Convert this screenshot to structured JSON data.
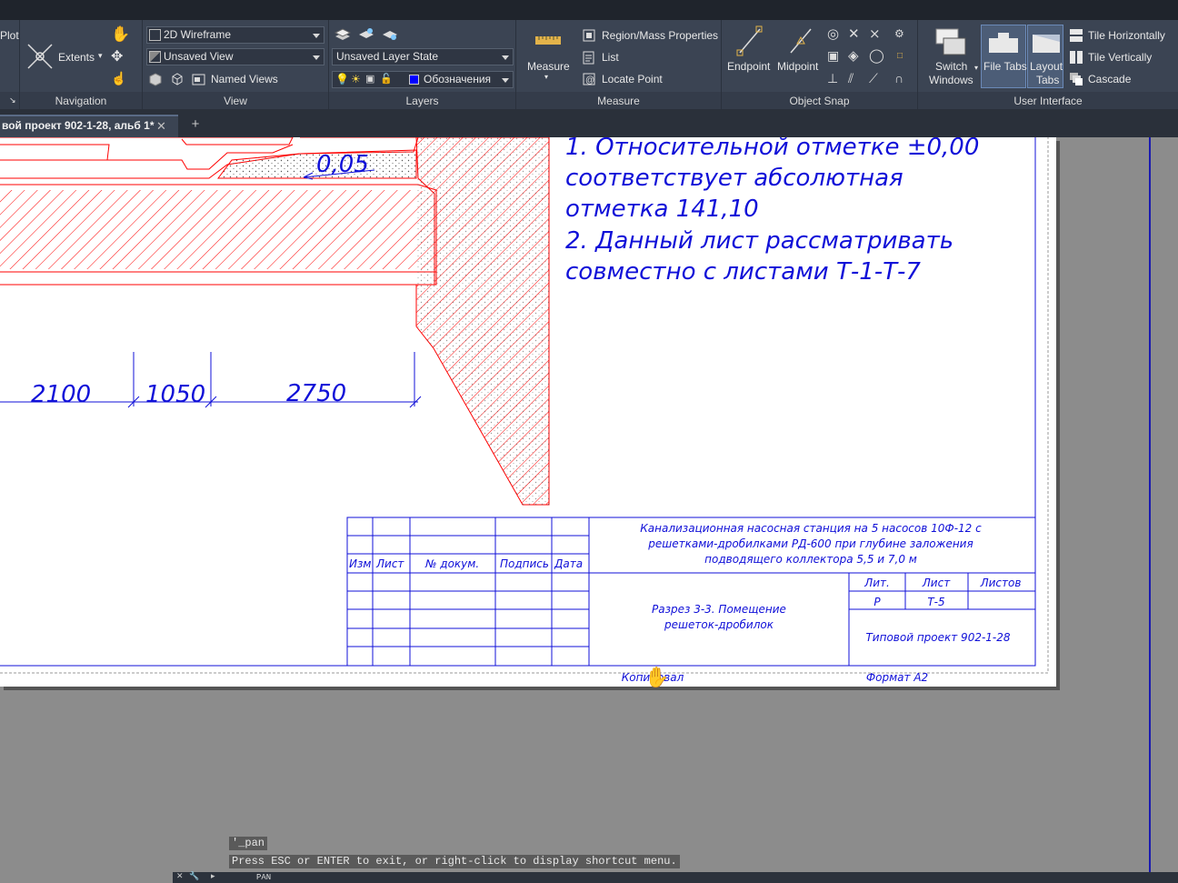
{
  "ribbon": {
    "plot_fragment": "Plot",
    "navigation": {
      "title": "Navigation",
      "extents_label": "Extents"
    },
    "view": {
      "title": "View",
      "visual_style": "2D Wireframe",
      "named_view_combo": "Unsaved View",
      "named_views_label": "Named Views"
    },
    "layers": {
      "title": "Layers",
      "layer_state": "Unsaved Layer State",
      "current_layer": "Обозначения",
      "layer_color": "#0000ff"
    },
    "measure": {
      "title": "Measure",
      "measure_label": "Measure",
      "region_mass": "Region/Mass Properties",
      "list": "List",
      "locate_point": "Locate Point"
    },
    "object_snap": {
      "title": "Object Snap",
      "endpoint": "Endpoint",
      "midpoint": "Midpoint"
    },
    "user_interface": {
      "title": "User Interface",
      "switch_windows_1": "Switch",
      "switch_windows_2": "Windows",
      "file_tabs": "File Tabs",
      "layout_tabs_1": "Layout",
      "layout_tabs_2": "Tabs",
      "tile_horizontally": "Tile Horizontally",
      "tile_vertically": "Tile Vertically",
      "cascade": "Cascade"
    }
  },
  "file_tab": {
    "label": "вой проект 902-1-28, альб 1*",
    "close": "✕",
    "new": "+"
  },
  "drawing": {
    "notes": [
      "1. Относительной отметке ±0,00",
      "соответствует абсолютная",
      "отметка 141,10",
      "2. Данный лист рассматривать",
      "совместно с листами Т-1-Т-7"
    ],
    "slope_label": "0,05",
    "dimensions": [
      "2100",
      "1050",
      "2750"
    ],
    "title_block": {
      "headers": [
        "Изм",
        "Лист",
        "№ докум.",
        "Подпись",
        "Дата"
      ],
      "project_title": [
        "Канализационная насосная станция на 5 насосов 10Ф-12 с",
        "решетками-дробилками РД-600 при глубине заложения",
        "подводящего коллектора 5,5 и 7,0 м"
      ],
      "sheet_title": [
        "Разрез 3-3. Помещение",
        "решеток-дробилок"
      ],
      "lit_header": "Лит.",
      "sheet_header": "Лист",
      "sheets_header": "Листов",
      "lit_value": "Р",
      "sheet_value": "Т-5",
      "typical_project": "Типовой проект 902-1-28",
      "copied": "Копировал",
      "format": "Формат А2"
    }
  },
  "command_line": {
    "history_1": "'_pan",
    "history_2": "Press ESC or ENTER to exit, or right-click to display shortcut menu.",
    "prompt": "PAN"
  },
  "colors": {
    "hatch_red": "#ff0000",
    "annotation_blue": "#1010d8",
    "ribbon_bg": "#3b4453"
  }
}
